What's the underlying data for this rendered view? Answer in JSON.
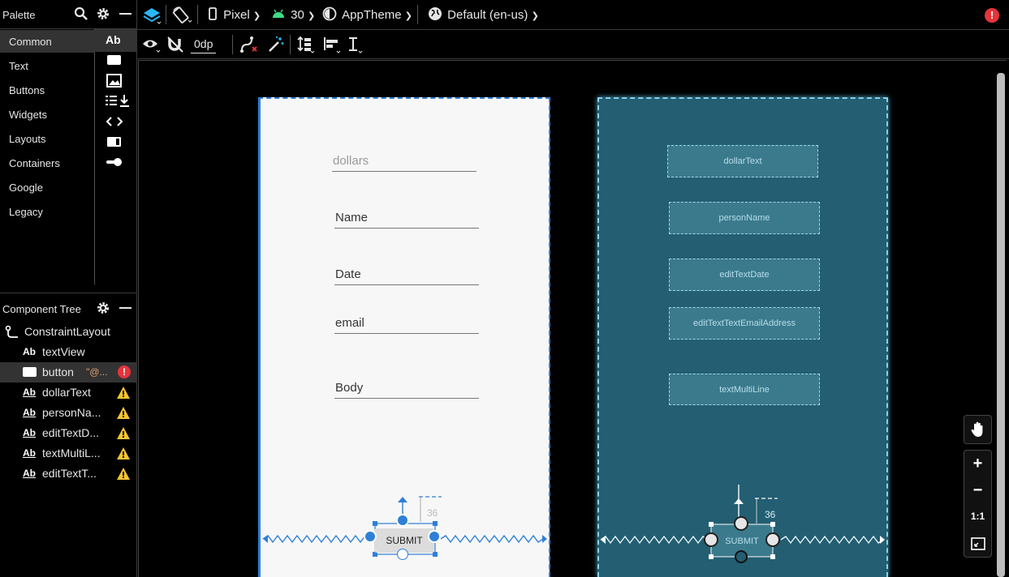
{
  "palette": {
    "title": "Palette",
    "categories": [
      "Common",
      "Text",
      "Buttons",
      "Widgets",
      "Layouts",
      "Containers",
      "Google",
      "Legacy"
    ],
    "selected_category": "Common",
    "first_item_glyph": "Ab"
  },
  "component_tree": {
    "title": "Component Tree",
    "root": "ConstraintLayout",
    "items": [
      {
        "glyph": "Ab",
        "label": "textView",
        "status": ""
      },
      {
        "glyph": "",
        "label": "button",
        "extra": "\"@...",
        "status": "error"
      },
      {
        "glyph": "Ab",
        "label": "dollarText",
        "status": "warning"
      },
      {
        "glyph": "Ab",
        "label": "personNa...",
        "status": "warning"
      },
      {
        "glyph": "Ab",
        "label": "editTextD...",
        "status": "warning"
      },
      {
        "glyph": "Ab",
        "label": "textMultiL...",
        "status": "warning"
      },
      {
        "glyph": "Ab",
        "label": "editTextT...",
        "status": "warning"
      }
    ]
  },
  "toolbar": {
    "device": "Pixel",
    "api": "30",
    "theme": "AppTheme",
    "locale": "Default (en-us)",
    "margin": "0dp",
    "error_badge": "!"
  },
  "design_preview": {
    "fields": [
      {
        "text": "dollars",
        "hint": true
      },
      {
        "text": "Name",
        "hint": false
      },
      {
        "text": "Date",
        "hint": false
      },
      {
        "text": "email",
        "hint": false
      },
      {
        "text": "Body",
        "hint": false
      }
    ],
    "submit_label": "SUBMIT",
    "margin_label": "36"
  },
  "blueprint_preview": {
    "boxes": [
      "dollarText",
      "personName",
      "editTextDate",
      "editTextTextEmailAddress",
      "textMultiLine"
    ],
    "submit_label": "SUBMIT",
    "margin_label": "36"
  },
  "zoom_controls": {
    "zoom_in": "+",
    "zoom_out": "−",
    "actual_size": "1:1"
  },
  "colors": {
    "accent_blue": "#2f7fd8",
    "blueprint_bg": "#235e72",
    "warning": "#f4c430",
    "error": "#e5343c"
  }
}
